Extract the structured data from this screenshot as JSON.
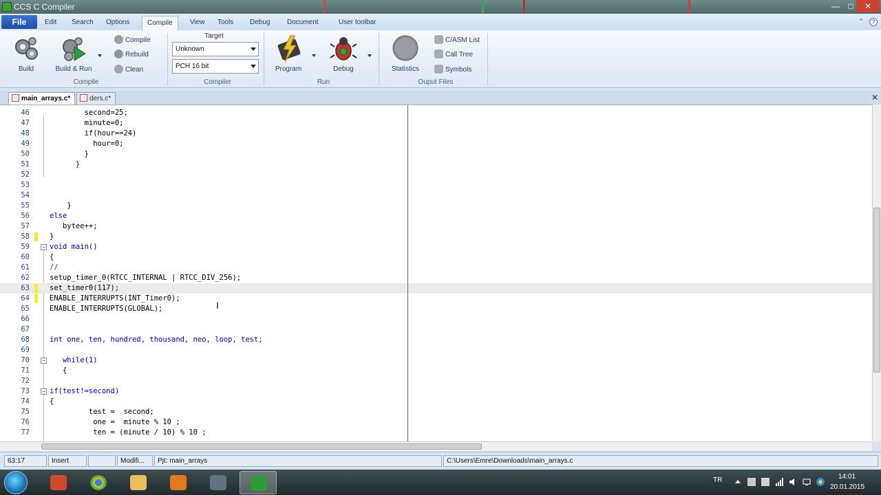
{
  "window": {
    "title": "CCS C Compiler"
  },
  "ribbon_tabs": {
    "file": "File",
    "items": [
      "Edit",
      "Search",
      "Options",
      "Compile",
      "View",
      "Tools",
      "Debug",
      "Document",
      "User toolbar"
    ],
    "active": "Compile"
  },
  "ribbon": {
    "compile_group": {
      "label": "Compile",
      "build": "Build",
      "build_run": "Build & Run",
      "compile": "Compile",
      "rebuild": "Rebuild",
      "clean": "Clean"
    },
    "compiler_group": {
      "label": "Compiler",
      "target_label": "Target",
      "target_value": "Unknown",
      "compiler_value": "PCH 16 bit"
    },
    "run_group": {
      "label": "Run",
      "program": "Program",
      "debug": "Debug"
    },
    "output_group": {
      "label": "Ouput Files",
      "statistics": "Statistics",
      "casm_list": "C/ASM List",
      "call_tree": "Call Tree",
      "symbols": "Symbols"
    }
  },
  "doc_tabs": {
    "active": "main_arrays.c*",
    "inactive": "ders.c*"
  },
  "editor": {
    "lines": [
      {
        "n": "46",
        "text": "        second=25;"
      },
      {
        "n": "47",
        "text": "        minute=0;"
      },
      {
        "n": "48",
        "text": "        if(hour==24)"
      },
      {
        "n": "49",
        "text": "          hour=0;"
      },
      {
        "n": "50",
        "text": "        }"
      },
      {
        "n": "51",
        "text": "      }"
      },
      {
        "n": "52",
        "text": ""
      },
      {
        "n": "53",
        "text": ""
      },
      {
        "n": "54",
        "text": ""
      },
      {
        "n": "55",
        "text": "    }"
      },
      {
        "n": "56",
        "text": "else"
      },
      {
        "n": "57",
        "text": "   bytee++;"
      },
      {
        "n": "58",
        "text": "}"
      },
      {
        "n": "59",
        "text": "void main()"
      },
      {
        "n": "60",
        "text": "{"
      },
      {
        "n": "61",
        "text": "//"
      },
      {
        "n": "62",
        "text": "setup_timer_0(RTCC_INTERNAL | RTCC_DIV_256);"
      },
      {
        "n": "63",
        "text": "set_timer0(117);"
      },
      {
        "n": "64",
        "text": "ENABLE_INTERRUPTS(INT_Timer0);"
      },
      {
        "n": "65",
        "text": "ENABLE_INTERRUPTS(GLOBAL);"
      },
      {
        "n": "66",
        "text": ""
      },
      {
        "n": "67",
        "text": ""
      },
      {
        "n": "68",
        "text": "int one, ten, hundred, thousand, neo, loop, test;"
      },
      {
        "n": "69",
        "text": ""
      },
      {
        "n": "70",
        "text": "   while(1)"
      },
      {
        "n": "71",
        "text": "   {"
      },
      {
        "n": "72",
        "text": ""
      },
      {
        "n": "73",
        "text": "if(test!=second)"
      },
      {
        "n": "74",
        "text": "{"
      },
      {
        "n": "75",
        "text": "         test =  second;"
      },
      {
        "n": "76",
        "text": "          one =  minute % 10 ;"
      },
      {
        "n": "77",
        "text": "          ten = (minute / 10) % 10 ;"
      }
    ]
  },
  "status": {
    "position": "63:17",
    "mode": "Insert",
    "modified": "Modifi...",
    "project": "Pjt: main_arrays",
    "path": "C:\\Users\\Emre\\Downloads\\main_arrays.c"
  },
  "taskbar": {
    "lang": "TR",
    "time": "14:01",
    "date": "20.01.2015"
  },
  "colors": {
    "keyword": "#0000c0",
    "number": "#007000",
    "accent": "#1c4fa8"
  }
}
